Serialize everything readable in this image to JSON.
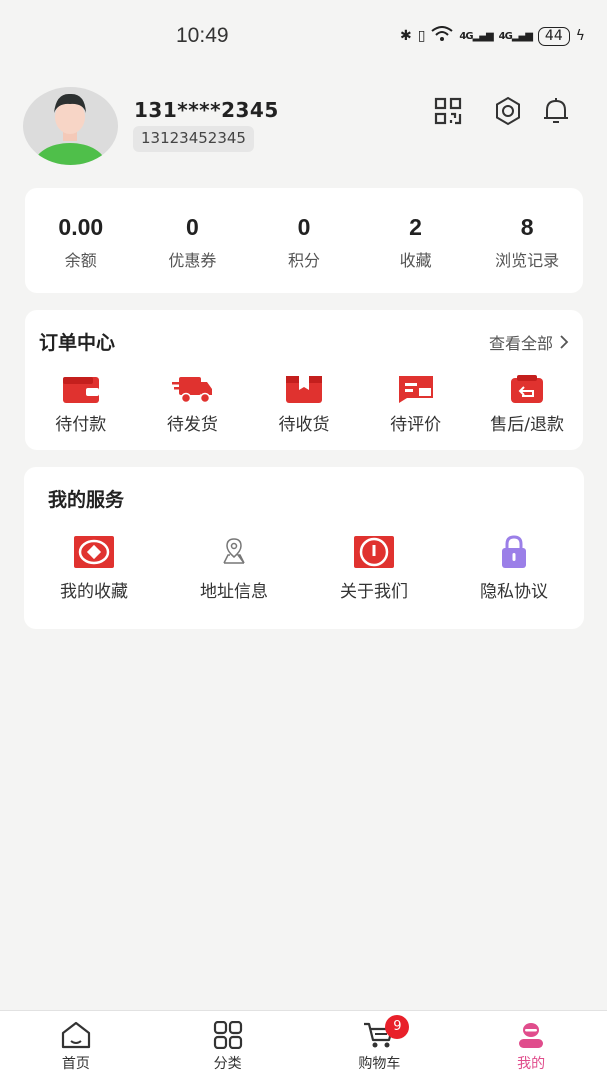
{
  "status": {
    "time": "10:49",
    "net1": "4G",
    "net2": "4G",
    "battery": "44"
  },
  "profile": {
    "display_name": "131****2345",
    "phone": "13123452345"
  },
  "stats": [
    {
      "value": "0.00",
      "label": "余额"
    },
    {
      "value": "0",
      "label": "优惠券"
    },
    {
      "value": "0",
      "label": "积分"
    },
    {
      "value": "2",
      "label": "收藏"
    },
    {
      "value": "8",
      "label": "浏览记录"
    }
  ],
  "orders": {
    "title": "订单中心",
    "view_all": "查看全部",
    "items": [
      {
        "label": "待付款",
        "icon": "wallet-icon"
      },
      {
        "label": "待发货",
        "icon": "truck-icon"
      },
      {
        "label": "待收货",
        "icon": "box-icon"
      },
      {
        "label": "待评价",
        "icon": "review-icon"
      },
      {
        "label": "售后/退款",
        "icon": "refund-icon"
      }
    ]
  },
  "services": {
    "title": "我的服务",
    "items": [
      {
        "label": "我的收藏",
        "icon": "favorites-icon"
      },
      {
        "label": "地址信息",
        "icon": "location-icon"
      },
      {
        "label": "关于我们",
        "icon": "info-icon"
      },
      {
        "label": "隐私协议",
        "icon": "lock-icon"
      }
    ]
  },
  "tabs": [
    {
      "label": "首页",
      "icon": "home-icon"
    },
    {
      "label": "分类",
      "icon": "grid-icon"
    },
    {
      "label": "购物车",
      "icon": "cart-icon",
      "badge": "9"
    },
    {
      "label": "我的",
      "icon": "profile-icon",
      "active": true
    }
  ],
  "colors": {
    "accent": "#e0322f",
    "tab_active": "#e04d8c",
    "lock": "#9b7fe8"
  }
}
